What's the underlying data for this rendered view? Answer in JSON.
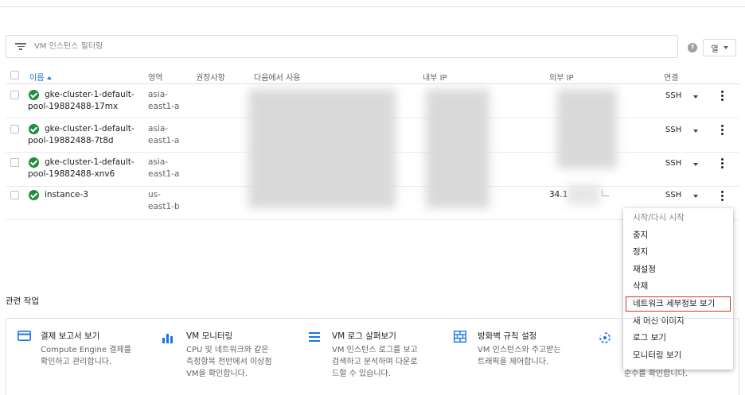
{
  "filter": {
    "placeholder": "VM 인스턴스 필터링"
  },
  "column_button": {
    "label": "열"
  },
  "table": {
    "headers": {
      "name": "이름",
      "zone": "영역",
      "recommendation": "권장사항",
      "in_use_by": "다음에서 사용",
      "internal_ip": "내부 IP",
      "external_ip": "외부 IP",
      "connect": "연결"
    },
    "rows": [
      {
        "name_line1": "gke-cluster-1-default-",
        "name_line2": "pool-19882488-17mx",
        "zone_line1": "asia-",
        "zone_line2": "east1-a",
        "external_ip": "",
        "connect": "SSH"
      },
      {
        "name_line1": "gke-cluster-1-default-",
        "name_line2": "pool-19882488-7t8d",
        "zone_line1": "asia-",
        "zone_line2": "east1-a",
        "external_ip": "",
        "connect": "SSH"
      },
      {
        "name_line1": "gke-cluster-1-default-",
        "name_line2": "pool-19882488-xnv6",
        "zone_line1": "asia-",
        "zone_line2": "east1-a",
        "external_ip": "",
        "connect": "SSH"
      },
      {
        "name_line1": "instance-3",
        "name_line2": "",
        "zone_line1": "us-",
        "zone_line2": "east1-b",
        "external_ip": "34.1",
        "connect": "SSH"
      }
    ]
  },
  "context_menu": {
    "items": [
      "시작/다시 시작",
      "중지",
      "정지",
      "재설정",
      "삭제",
      "네트워크 세부정보 보기",
      "새 머신 이미지",
      "로그 보기",
      "모니터링 보기"
    ],
    "highlight_color": "#d93025"
  },
  "related": {
    "title": "관련 작업",
    "cards": [
      {
        "title": "결제 보고서 보기",
        "desc1": "Compute Engine 결제를",
        "desc2": "확인하고 관리합니다.",
        "desc3": ""
      },
      {
        "title": "VM 모니터링",
        "desc1": "CPU 및 네트워크와 같은",
        "desc2": "측정항목 전반에서 이상점",
        "desc3": "VM을 확인합니다."
      },
      {
        "title": "VM 로그 살펴보기",
        "desc1": "VM 인스턴스 로그를 보고",
        "desc2": "검색하고 분석하며 다운로",
        "desc3": "드할 수 있습니다."
      },
      {
        "title": "방화벽 규칙 설정",
        "desc1": "VM 인스턴스와 주고받는",
        "desc2": "트래픽을 제어합니다.",
        "desc3": ""
      },
      {
        "title": "",
        "desc1": "",
        "desc2": "",
        "desc3": "순수를 확인합니다."
      }
    ]
  },
  "colors": {
    "accent": "#1a73e8",
    "status_ok": "#1e8e3e"
  }
}
